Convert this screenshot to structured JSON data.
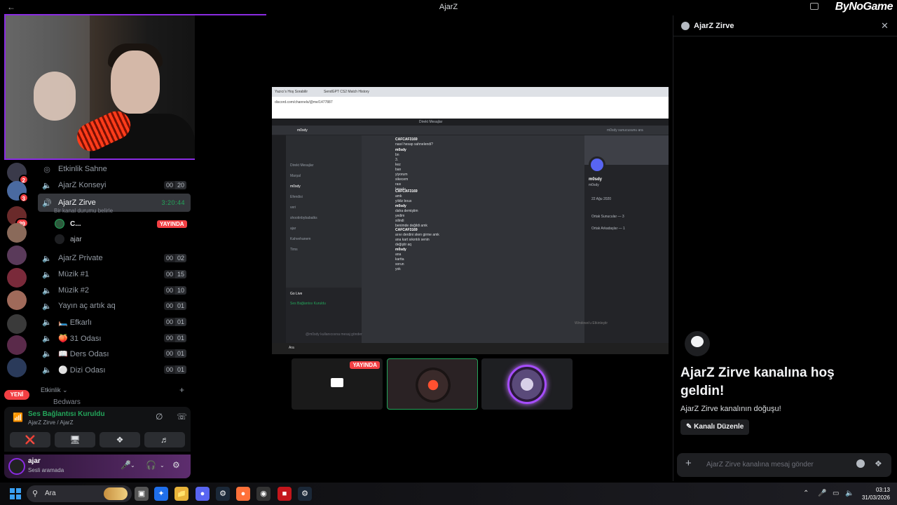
{
  "window": {
    "title": "AjarZ",
    "brand_logo": "ByNoGame"
  },
  "servers": [
    {
      "badge": "2"
    },
    {
      "badge": "3"
    },
    {
      "badge": "39"
    },
    {
      "badge": ""
    },
    {
      "badge": ""
    },
    {
      "badge": ""
    },
    {
      "badge": ""
    },
    {
      "badge": ""
    }
  ],
  "servers_new_label": "YENİ",
  "channels": [
    {
      "name": "Etkinlik Sahne",
      "icon": "stage-icon",
      "users": "",
      "limit": ""
    },
    {
      "name": "AjarZ Konseyi",
      "icon": "speaker-icon",
      "users": "00",
      "limit": "20"
    },
    {
      "name": "AjarZ Private",
      "icon": "speaker-icon",
      "users": "00",
      "limit": "02"
    },
    {
      "name": "Müzik #1",
      "icon": "speaker-icon",
      "users": "00",
      "limit": "15"
    },
    {
      "name": "Müzik #2",
      "icon": "speaker-icon",
      "users": "00",
      "limit": "10"
    },
    {
      "name": "Yayın aç artık aq",
      "icon": "speaker-icon",
      "users": "00",
      "limit": "01"
    },
    {
      "name": "🛏️ Efkarlı",
      "icon": "speaker-icon",
      "users": "00",
      "limit": "01"
    },
    {
      "name": "🍑 31 Odası",
      "icon": "speaker-icon",
      "users": "00",
      "limit": "01"
    },
    {
      "name": "📖 Ders Odası",
      "icon": "speaker-icon",
      "users": "00",
      "limit": "01"
    },
    {
      "name": "⚪ Dizi Odası",
      "icon": "speaker-icon",
      "users": "00",
      "limit": "01"
    }
  ],
  "active_channel": {
    "name": "AjarZ Zirve",
    "duration": "3:20:44",
    "status_placeholder": "Bir kanal durumu belirle",
    "members": [
      {
        "name": "C...",
        "live": "YAYINDA"
      },
      {
        "name": "ajar",
        "live": ""
      }
    ]
  },
  "category": {
    "name": "Etkinlik",
    "next_channel": "Bedwars"
  },
  "voice_panel": {
    "status": "Ses Bağlantısı Kuruldu",
    "location": "AjarZ Zirve / AjarZ"
  },
  "user": {
    "name": "ajar",
    "status": "Sesli aramada"
  },
  "stage": {
    "screen": {
      "browser_tabs": [
        "Yazıcı's Hoş Sorabilir",
        "SendGPT CS2 Match History"
      ],
      "url": "discord.com/channels/@me/1477887",
      "dm_header": "Direkt Mesajlar",
      "dm_user": "m0sdy",
      "search_placeholder": "m0sdy sunucusunu ara",
      "dm_list": [
        "Direkt Mesajlar",
        "Marşal",
        "m0sdy",
        "Efendisi",
        "veri",
        "shootinbybabalks",
        "ajar",
        "Kahvehanem",
        "Tims"
      ],
      "messages": [
        {
          "author": "CAFCAF3169",
          "lines": [
            "nasıl hesap sahnelendi?"
          ]
        },
        {
          "author": "m0sdy",
          "lines": [
            "bn",
            "3.",
            "kez",
            "ban",
            "yiyorum",
            "sikecem",
            "rası",
            "hesabı"
          ]
        },
        {
          "author": "CAFCAF3169",
          "lines": [
            "amk",
            "yildiz bous"
          ]
        },
        {
          "author": "m0sdy",
          "lines": [
            "daha demiştim",
            "yedim",
            "silindi",
            "benimde değildi amk"
          ]
        },
        {
          "author": "CAFCAF3169",
          "lines": [
            "arıvı derdini sken girme amk",
            "ana kart sıkıntılı senin",
            "değiştir aq"
          ]
        },
        {
          "author": "m0sdy",
          "lines": [
            "ana",
            "kartta",
            "sorun",
            "yok"
          ]
        }
      ],
      "composer_placeholder": "@m0sdy kullanıcısına mesaj gönder",
      "go_live": "Go Live",
      "voice_connected": "Ses Bağlantısı Kuruldu",
      "profile": {
        "name": "m0sdy",
        "handle": "m0sdy",
        "member_since": "22 Ağu 2020",
        "mutual_servers": "Ortak Sunucular — 3",
        "mutual_friends": "Ortak Arkadaşlar — 1"
      },
      "watermark": "Windows'u Etkinleştir",
      "taskbar_search": "Ara"
    },
    "tiles": [
      {
        "label": "YAYINDA"
      },
      {
        "label": ""
      },
      {
        "label": ""
      }
    ]
  },
  "right_panel": {
    "title": "AjarZ Zirve",
    "welcome_title": "AjarZ Zirve kanalına hoş geldin!",
    "welcome_sub": "AjarZ Zirve kanalının doğuşu!",
    "edit_button": "Kanalı Düzenle",
    "composer_placeholder": "AjarZ Zirve kanalına mesaj gönder"
  },
  "taskbar": {
    "search_label": "Ara",
    "time": "03:13",
    "date": "31/03/2026",
    "apps": [
      "discord",
      "steam",
      "firefox",
      "chrome",
      "app-red",
      "steam-2"
    ]
  },
  "colors": {
    "accent": "#8a2be2",
    "online": "#23a55a",
    "live": "#f23f43",
    "bg": "#000000"
  }
}
